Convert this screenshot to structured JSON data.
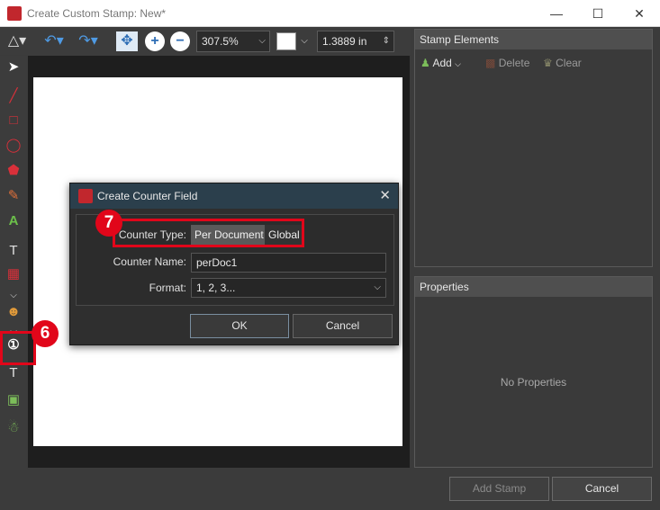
{
  "window": {
    "title": "Create Custom Stamp: New*"
  },
  "toolbar": {
    "zoom": "307.5%",
    "width_value": "1.3889 in"
  },
  "stamp_elements": {
    "header": "Stamp Elements",
    "add_label": "Add",
    "delete_label": "Delete",
    "clear_label": "Clear"
  },
  "properties": {
    "header": "Properties",
    "empty_text": "No Properties"
  },
  "footer": {
    "add_stamp_label": "Add Stamp",
    "cancel_label": "Cancel"
  },
  "dialog": {
    "title": "Create Counter Field",
    "counter_type_label": "Counter Type:",
    "counter_type_options": [
      "Per Document",
      "Global"
    ],
    "counter_type_selected": "Per Document",
    "counter_name_label": "Counter Name:",
    "counter_name_value": "perDoc1",
    "format_label": "Format:",
    "format_value": "1, 2, 3...",
    "ok_label": "OK",
    "cancel_label": "Cancel"
  },
  "callouts": {
    "step_six": "6",
    "step_seven": "7"
  },
  "colors": {
    "accent_red": "#e1061a",
    "dialog_title_bg": "#2b3f4c"
  }
}
